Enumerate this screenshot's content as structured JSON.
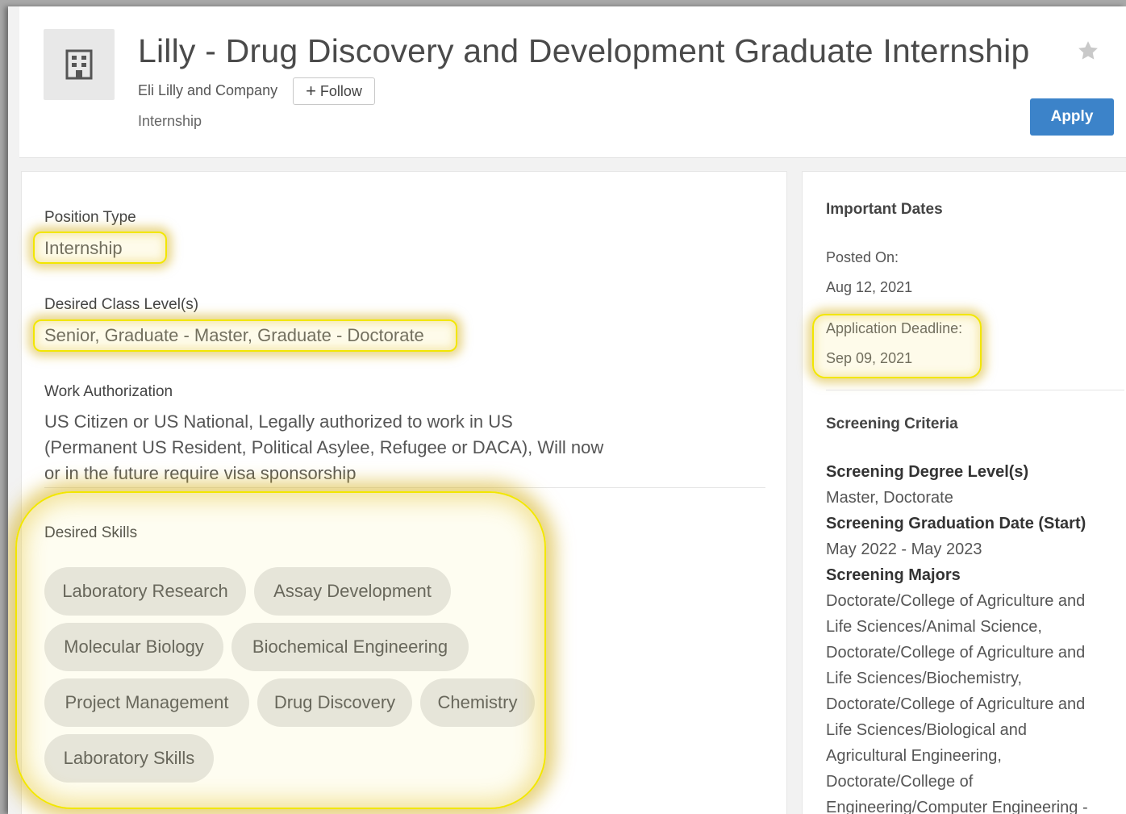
{
  "header": {
    "title": "Lilly - Drug Discovery and Development Graduate Internship",
    "company": "Eli Lilly and Company",
    "follow_label": "Follow",
    "job_type": "Internship",
    "apply_label": "Apply"
  },
  "details": {
    "position_type_label": "Position Type",
    "position_type_value": "Internship",
    "class_level_label": "Desired Class Level(s)",
    "class_level_value": "Senior, Graduate - Master, Graduate - Doctorate",
    "work_auth_label": "Work Authorization",
    "work_auth_value": "US Citizen or US National, Legally authorized to work in US (Permanent US Resident, Political Asylee, Refugee or DACA), Will now or in the future require visa sponsorship",
    "skills_label": "Desired Skills",
    "skills": [
      "Laboratory Research",
      "Assay Development",
      "Molecular Biology",
      "Biochemical Engineering",
      "Project Management",
      "Drug Discovery",
      "Chemistry",
      "Laboratory Skills"
    ]
  },
  "sidebar": {
    "dates_title": "Important Dates",
    "posted_label": "Posted On:",
    "posted_value": "Aug 12, 2021",
    "deadline_label": "Application Deadline:",
    "deadline_value": "Sep 09, 2021",
    "criteria_title": "Screening Criteria",
    "criteria": [
      {
        "heading": "Screening Degree Level(s)",
        "value": "Master, Doctorate"
      },
      {
        "heading": "Screening Graduation Date (Start)",
        "value": "May 2022 - May 2023"
      },
      {
        "heading": "Screening Majors",
        "value": "Doctorate/College of Agriculture and Life Sciences/Animal Science, Doctorate/College of Agriculture and Life Sciences/Biochemistry, Doctorate/College of Agriculture and Life Sciences/Biological and Agricultural Engineering, Doctorate/College of Engineering/Computer Engineering -"
      }
    ]
  },
  "icons": {
    "logo": "building-icon",
    "favorite": "star-icon",
    "follow": "plus-icon"
  },
  "colors": {
    "accent": "#3c83c9",
    "highlight": "#f2e600"
  }
}
